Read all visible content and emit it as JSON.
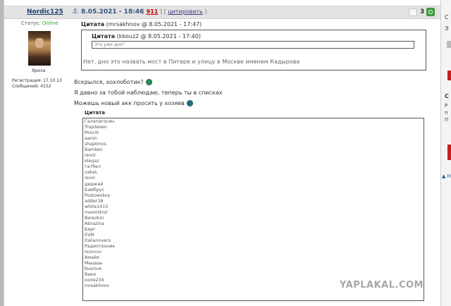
{
  "post": {
    "author": "Nordic125",
    "date": "8.05.2021 - 18:46",
    "links": {
      "open_bracket": "[ ",
      "post_number": "911",
      "separator": " ] [ ",
      "cite": "цитировать",
      "close_bracket": " ]"
    },
    "rating_count": "3"
  },
  "user": {
    "status_label": "Статус: ",
    "status_value": "Online",
    "avatar_caption": "Ярила",
    "registration": "Регистрация: 17.10.13",
    "messages": "Сообщений: 4152"
  },
  "quote1": {
    "label_bold": "Цитата",
    "label_rest": " (mrsakhnov @ 8.05.2021 - 17:47)",
    "inner_label_bold": "Цитата",
    "inner_label_rest": " (kkouz2 @ 8.05.2021 - 17:40)",
    "inner_text": "Это уже дно?",
    "text": "Нет, дно это назвать мост в Питере и улицу в Москве именем Кадырова"
  },
  "body": {
    "line1": "Вскрылся, хохлоботик?",
    "line2": "Я давно за тобой наблюдаю, теперь ты в списках",
    "line3": "Можешь новый акк просить у хозяев"
  },
  "quote2": {
    "label": "Цитата",
    "names": [
      "Галапагосян",
      "Tropilexen",
      "Poncik",
      "aaron",
      "shaptmos",
      "Bambez",
      "revol",
      "elegaz",
      "татбел",
      "vakaL",
      "iovoi",
      "диджей",
      "Бамбрус",
      "Postowskoy",
      "adder38",
      "white1415",
      "moomitrol",
      "Berezkin",
      "Abrazina",
      "Берг",
      "EVM",
      "italianovero",
      "Радиотехник",
      "lozovvv",
      "Амайя",
      "Мышшь",
      "бнопня",
      "Ваки",
      "коля234",
      "mrsakhnov"
    ]
  },
  "watermark": "YAPLAKAL.COM",
  "right_strip": {
    "a": "С",
    "b": "Э",
    "c": "С",
    "d": "Р",
    "e": "п",
    "f": "П",
    "link": "▲ Н"
  }
}
